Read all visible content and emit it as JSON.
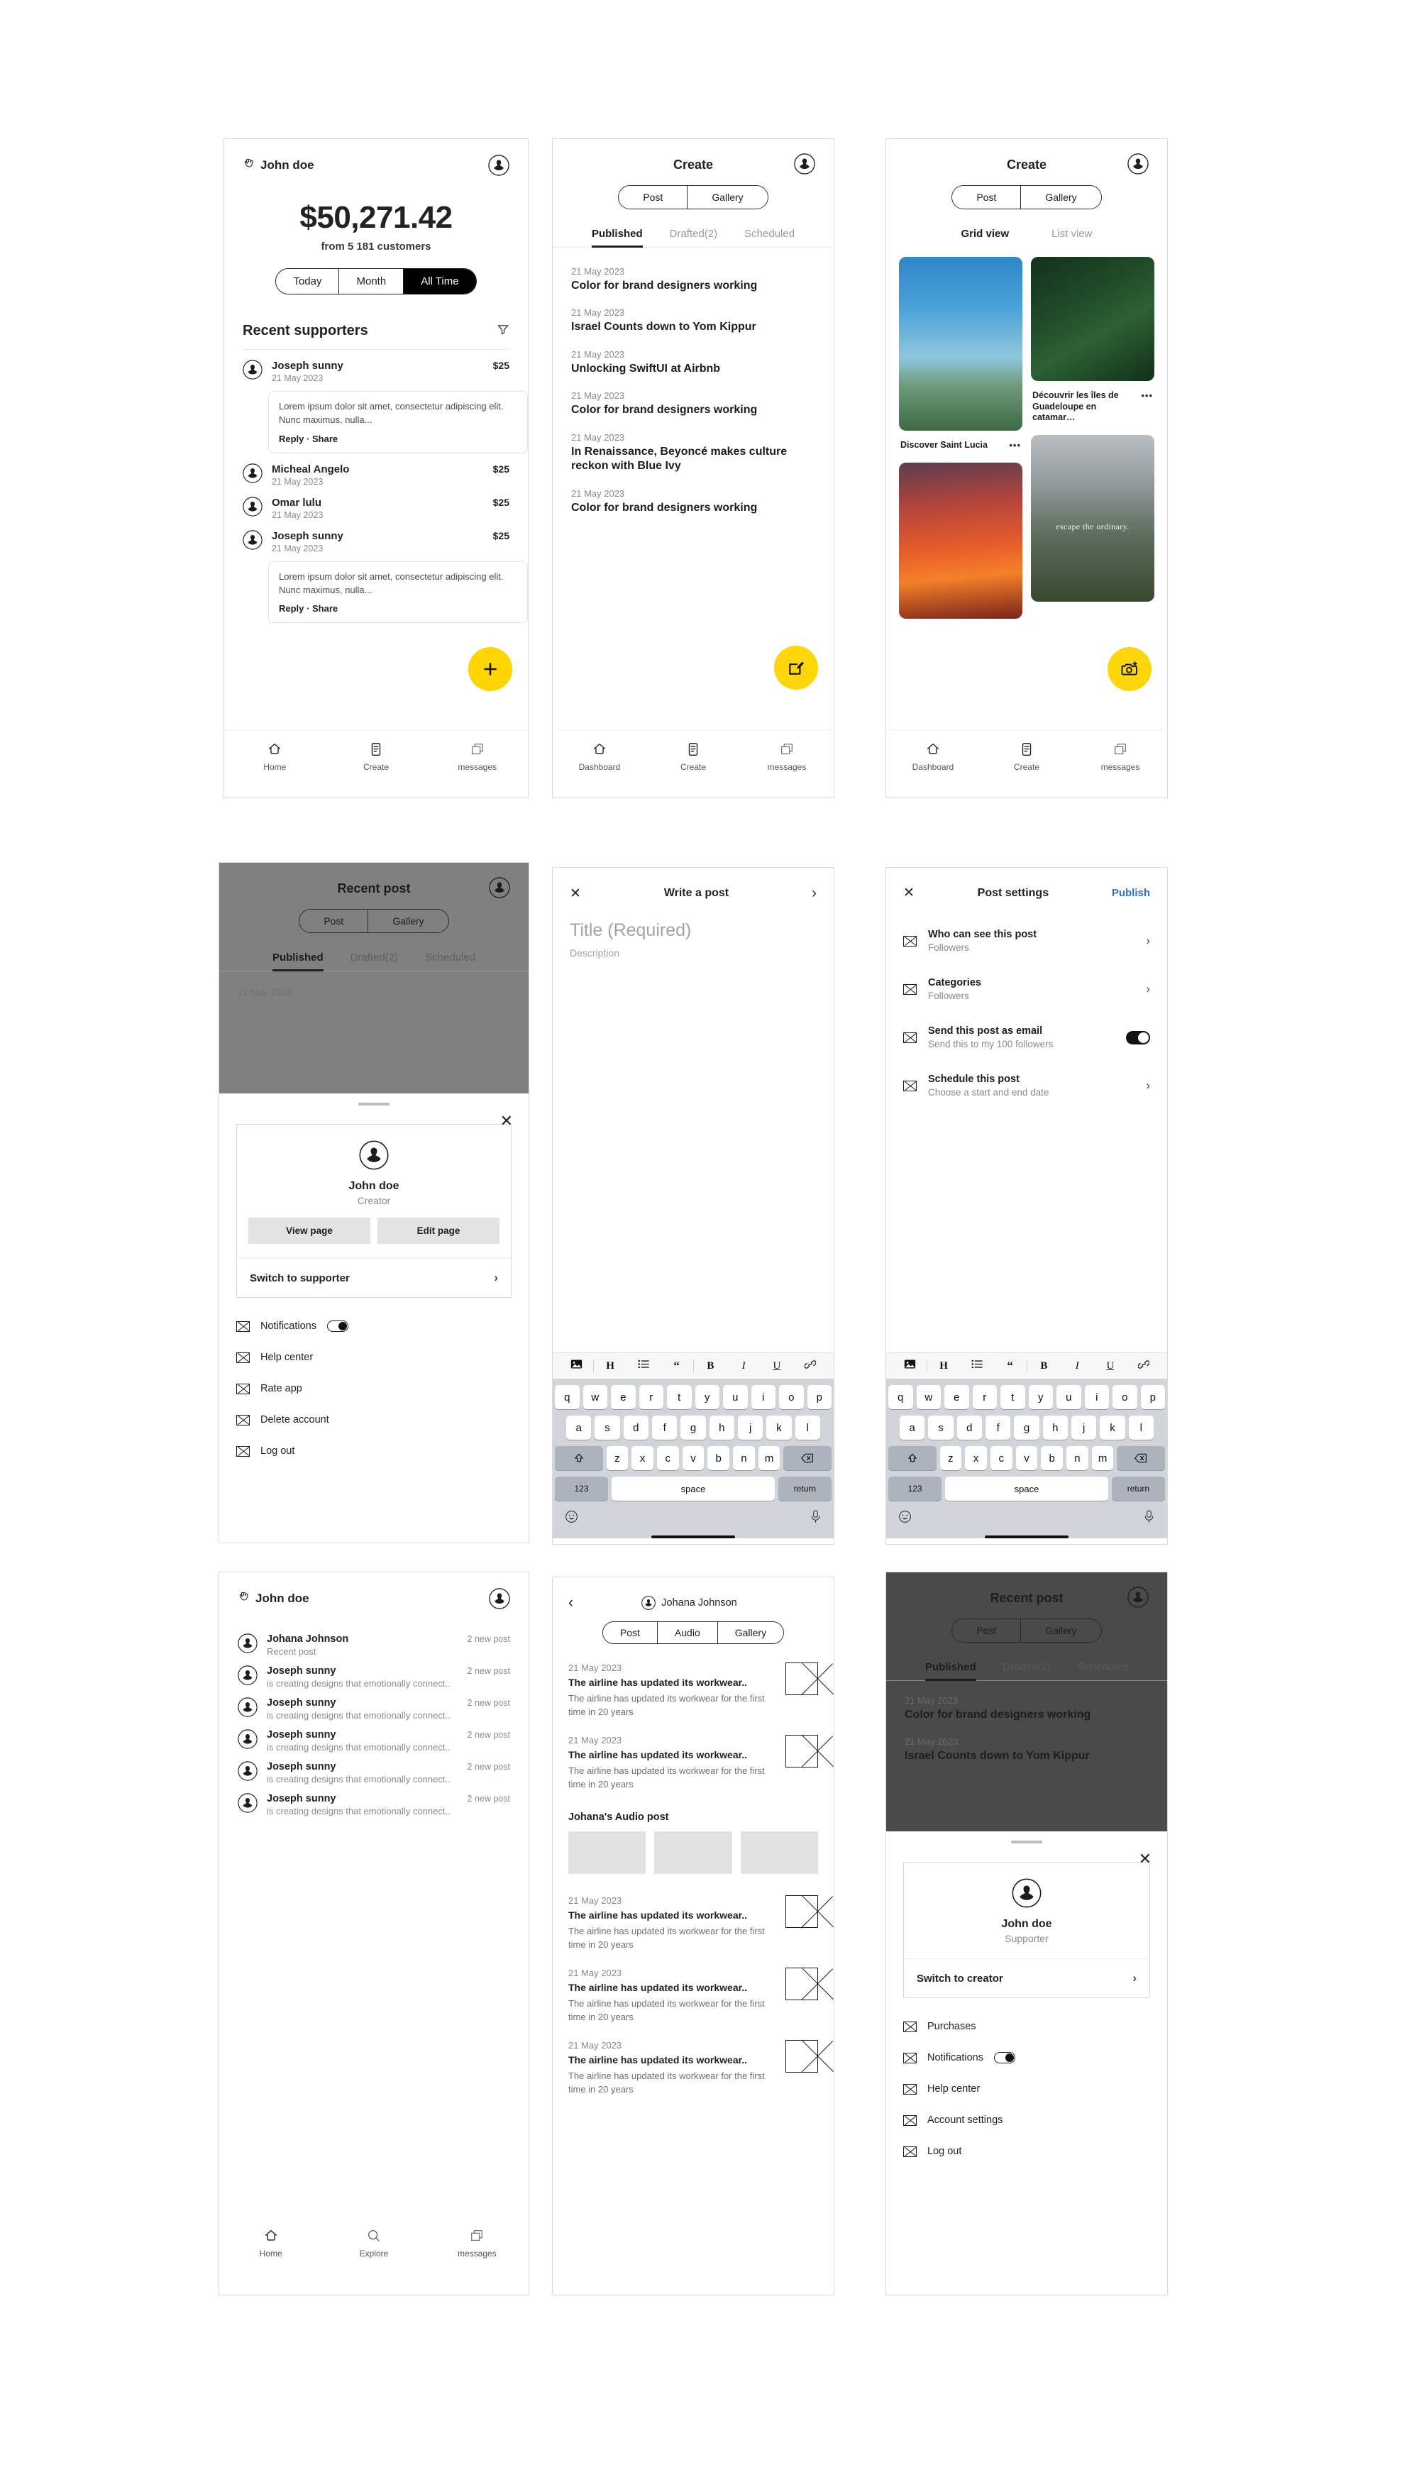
{
  "brand": {
    "accent_yellow": "#FFD60A",
    "publish_blue": "#2f6fd0",
    "black": "#111111"
  },
  "screen1": {
    "header_name": "John doe",
    "balance": {
      "amount": "$50,271.42",
      "subtitle": "from 5 181 customers"
    },
    "range_tabs": [
      {
        "label": "Today",
        "active": false
      },
      {
        "label": "Month",
        "active": false
      },
      {
        "label": "All Time",
        "active": true
      }
    ],
    "section_title": "Recent supporters",
    "supporters": [
      {
        "name": "Joseph sunny",
        "date": "21 May 2023",
        "amount": "$25",
        "comment": "Lorem ipsum dolor sit amet, consectetur adipiscing elit. Nunc maximus, nulla...",
        "reply": "Reply",
        "share": "Share"
      },
      {
        "name": "Micheal Angelo",
        "date": "21 May 2023",
        "amount": "$25",
        "comment": null
      },
      {
        "name": "Omar lulu",
        "date": "21 May 2023",
        "amount": "$25",
        "comment": null
      },
      {
        "name": "Joseph sunny",
        "date": "21 May 2023",
        "amount": "$25",
        "comment": "Lorem ipsum dolor sit amet, consectetur adipiscing elit. Nunc maximus, nulla...",
        "reply": "Reply",
        "share": "Share"
      }
    ],
    "fab": "+",
    "nav": [
      {
        "label": "Home"
      },
      {
        "label": "Create"
      },
      {
        "label": "messages"
      }
    ]
  },
  "screen2": {
    "title": "Create",
    "segments": [
      {
        "label": "Post"
      },
      {
        "label": "Gallery"
      }
    ],
    "tabs": [
      {
        "label": "Published",
        "active": true
      },
      {
        "label": "Drafted(2)",
        "active": false
      },
      {
        "label": "Scheduled",
        "active": false
      }
    ],
    "posts": [
      {
        "date": "21 May 2023",
        "title": "Color for brand designers working"
      },
      {
        "date": "21 May 2023",
        "title": "Israel Counts down to Yom Kippur"
      },
      {
        "date": "21 May 2023",
        "title": "Unlocking SwiftUI at Airbnb"
      },
      {
        "date": "21 May 2023",
        "title": "Color for brand designers working"
      },
      {
        "date": "21 May 2023",
        "title": "In Renaissance, Beyoncé makes culture reckon with Blue Ivy"
      },
      {
        "date": "21 May 2023",
        "title": "Color for brand designers working"
      }
    ],
    "nav": [
      {
        "label": "Dashboard"
      },
      {
        "label": "Create"
      },
      {
        "label": "messages"
      }
    ]
  },
  "screen3": {
    "title": "Create",
    "segments": [
      {
        "label": "Post"
      },
      {
        "label": "Gallery"
      }
    ],
    "view_tabs": [
      {
        "label": "Grid view",
        "active": true
      },
      {
        "label": "List view",
        "active": false
      }
    ],
    "gallery": [
      {
        "caption": "Discover Saint Lucia",
        "menu": "•••",
        "image": "palm-beach"
      },
      {
        "caption": "Découvrir les îles de Guadeloupe en catamar…",
        "menu": "•••",
        "image": "green-fern"
      },
      {
        "caption": "",
        "menu": "",
        "image": "sunset-tree"
      },
      {
        "caption": "",
        "menu": "",
        "image": "volcano-waterfall",
        "overlay": "escape the ordinary."
      }
    ],
    "nav": [
      {
        "label": "Dashboard"
      },
      {
        "label": "Create"
      },
      {
        "label": "messages"
      }
    ]
  },
  "screen4": {
    "background": {
      "title": "Recent post",
      "segments": [
        {
          "label": "Post"
        },
        {
          "label": "Gallery"
        }
      ],
      "tabs": [
        {
          "label": "Published",
          "active": true
        },
        {
          "label": "Drafted(2)",
          "active": false
        },
        {
          "label": "Scheduled",
          "active": false
        }
      ],
      "post_date": "21 May 2023"
    },
    "sheet": {
      "close": "✕",
      "profile": {
        "name": "John doe",
        "role": "Creator"
      },
      "buttons": [
        {
          "label": "View page"
        },
        {
          "label": "Edit page"
        }
      ],
      "switch": {
        "label": "Switch to supporter",
        "chevron": "›"
      },
      "menu": [
        {
          "label": "Notifications",
          "toggle": true
        },
        {
          "label": "Help center",
          "toggle": false
        },
        {
          "label": "Rate app",
          "toggle": false
        },
        {
          "label": "Delete account",
          "toggle": false
        },
        {
          "label": "Log out",
          "toggle": false
        }
      ]
    }
  },
  "screen5": {
    "header": {
      "close": "✕",
      "title": "Write a post",
      "next": "›"
    },
    "title_placeholder": "Title (Required)",
    "description_placeholder": "Description",
    "toolbar": [
      "image-icon",
      "H",
      "list-icon",
      "quote-icon",
      "B",
      "I",
      "U",
      "link-icon"
    ],
    "keyboard": {
      "row1": [
        "q",
        "w",
        "e",
        "r",
        "t",
        "y",
        "u",
        "i",
        "o",
        "p"
      ],
      "row2": [
        "a",
        "s",
        "d",
        "f",
        "g",
        "h",
        "j",
        "k",
        "l"
      ],
      "row3": [
        "z",
        "x",
        "c",
        "v",
        "b",
        "n",
        "m"
      ],
      "shift": "⇧",
      "backspace": "⌫",
      "num": "123",
      "space": "space",
      "return": "return",
      "emoji": "emoji-icon",
      "mic": "mic-icon"
    }
  },
  "screen6": {
    "header": {
      "close": "✕",
      "title": "Post settings",
      "publish": "Publish"
    },
    "items": [
      {
        "label": "Who can see this post",
        "sub": "Followers",
        "control": "chevron",
        "chevron": "›"
      },
      {
        "label": "Categories",
        "sub": "Followers",
        "control": "chevron",
        "chevron": "›"
      },
      {
        "label": "Send this post as email",
        "sub": "Send this to my 100 followers",
        "control": "toggle"
      },
      {
        "label": "Schedule this post",
        "sub": "Choose a start and end date",
        "control": "chevron",
        "chevron": "›"
      }
    ],
    "keyboard": {
      "row1": [
        "q",
        "w",
        "e",
        "r",
        "t",
        "y",
        "u",
        "i",
        "o",
        "p"
      ],
      "row2": [
        "a",
        "s",
        "d",
        "f",
        "g",
        "h",
        "j",
        "k",
        "l"
      ],
      "row3": [
        "z",
        "x",
        "c",
        "v",
        "b",
        "n",
        "m"
      ],
      "shift": "⇧",
      "backspace": "⌫",
      "num": "123",
      "space": "space",
      "return": "return"
    },
    "toolbar": [
      "image-icon",
      "H",
      "list-icon",
      "quote-icon",
      "B",
      "I",
      "U",
      "link-icon"
    ]
  },
  "screen7": {
    "header_name": "John doe",
    "notifications": [
      {
        "name": "Johana Johnson",
        "count": "2 new post",
        "sub": "Recent post"
      },
      {
        "name": "Joseph sunny",
        "count": "2 new post",
        "sub": "is creating designs that emotionally connect.."
      },
      {
        "name": "Joseph sunny",
        "count": "2 new post",
        "sub": "is creating designs that emotionally connect.."
      },
      {
        "name": "Joseph sunny",
        "count": "2 new post",
        "sub": "is creating designs that emotionally connect.."
      },
      {
        "name": "Joseph sunny",
        "count": "2 new post",
        "sub": "is creating designs that emotionally connect.."
      },
      {
        "name": "Joseph sunny",
        "count": "2 new post",
        "sub": "is creating designs that emotionally connect.."
      }
    ],
    "nav": [
      {
        "label": "Home"
      },
      {
        "label": "Explore"
      },
      {
        "label": "messages"
      }
    ]
  },
  "screen8": {
    "back": "‹",
    "user": "Johana Johnson",
    "segments": [
      {
        "label": "Post"
      },
      {
        "label": "Audio"
      },
      {
        "label": "Gallery"
      }
    ],
    "posts": [
      {
        "date": "21 May 2023",
        "title": "The airline has updated its workwear..",
        "desc": "The airline has updated its workwear for the first time in 20 years"
      },
      {
        "date": "21 May 2023",
        "title": "The airline has updated its workwear..",
        "desc": "The airline has updated its workwear for the first time in 20 years"
      }
    ],
    "audio_section_title": "Johana's Audio post",
    "audio_tiles": 3,
    "posts2": [
      {
        "date": "21 May 2023",
        "title": "The airline has updated its workwear..",
        "desc": "The airline has updated its workwear for the first time in 20 years"
      },
      {
        "date": "21 May 2023",
        "title": "The airline has updated its workwear..",
        "desc": "The airline has updated its workwear for the first time in 20 years"
      },
      {
        "date": "21 May 2023",
        "title": "The airline has updated its workwear..",
        "desc": "The airline has updated its workwear for the first time in 20 years"
      }
    ]
  },
  "screen9": {
    "background": {
      "title": "Recent post",
      "segments": [
        {
          "label": "Post"
        },
        {
          "label": "Gallery"
        }
      ],
      "tabs": [
        {
          "label": "Published",
          "active": true
        },
        {
          "label": "Drafted(2)",
          "active": false
        },
        {
          "label": "Scheduled",
          "active": false
        }
      ],
      "posts": [
        {
          "date": "21 May 2023",
          "title": "Color for brand designers working"
        },
        {
          "date": "21 May 2023",
          "title": "Israel Counts down to Yom Kippur"
        }
      ]
    },
    "sheet": {
      "close": "✕",
      "profile": {
        "name": "John doe",
        "role": "Supporter"
      },
      "switch": {
        "label": "Switch to creator",
        "chevron": "›"
      },
      "menu": [
        {
          "label": "Purchases",
          "toggle": false
        },
        {
          "label": "Notifications",
          "toggle": true
        },
        {
          "label": "Help center",
          "toggle": false
        },
        {
          "label": "Account settings",
          "toggle": false
        },
        {
          "label": "Log out",
          "toggle": false
        }
      ]
    }
  }
}
